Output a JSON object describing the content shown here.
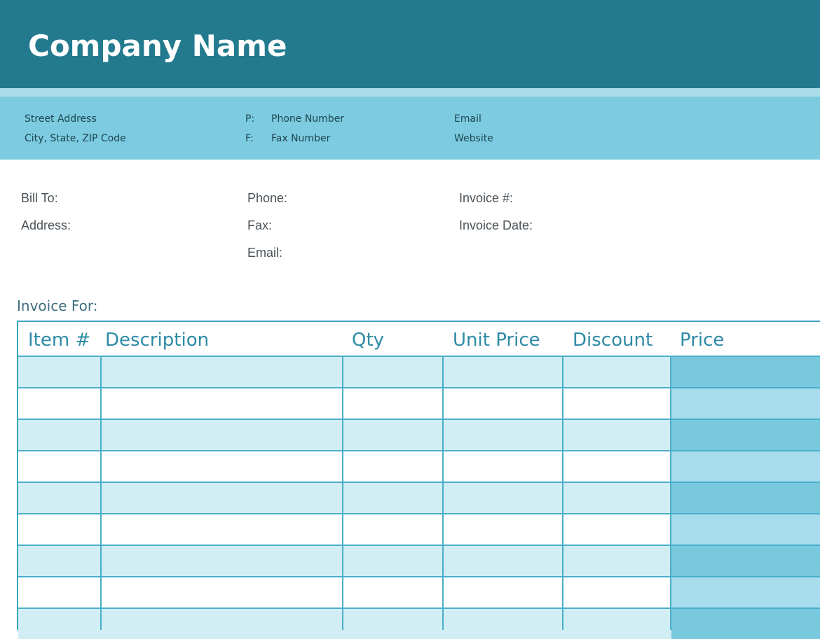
{
  "header": {
    "company_name": "Company Name"
  },
  "contact": {
    "street_address": "Street Address",
    "city_state_zip": "City, State, ZIP Code",
    "phone_prefix": "P:",
    "phone_number": "Phone Number",
    "fax_prefix": "F:",
    "fax_number": "Fax Number",
    "email": "Email",
    "website": "Website"
  },
  "bill_info": {
    "bill_to_label": "Bill To:",
    "address_label": "Address:",
    "phone_label": "Phone:",
    "fax_label": "Fax:",
    "email_label": "Email:",
    "invoice_number_label": "Invoice #:",
    "invoice_date_label": "Invoice Date:"
  },
  "invoice_for": {
    "label": "Invoice For:"
  },
  "table": {
    "columns": [
      "Item #",
      "Description",
      "Qty",
      "Unit Price",
      "Discount",
      "Price"
    ],
    "rows": [
      [
        "",
        "",
        "",
        "",
        "",
        ""
      ],
      [
        "",
        "",
        "",
        "",
        "",
        ""
      ],
      [
        "",
        "",
        "",
        "",
        "",
        ""
      ],
      [
        "",
        "",
        "",
        "",
        "",
        ""
      ],
      [
        "",
        "",
        "",
        "",
        "",
        ""
      ],
      [
        "",
        "",
        "",
        "",
        "",
        ""
      ],
      [
        "",
        "",
        "",
        "",
        "",
        ""
      ],
      [
        "",
        "",
        "",
        "",
        "",
        ""
      ],
      [
        "",
        "",
        "",
        "",
        "",
        ""
      ]
    ]
  },
  "colors": {
    "header_band": "#237a8e",
    "contact_band": "#7ccbe0",
    "row_shaded": "#d1eef5",
    "price_column": "#79c9de",
    "accent_text": "#2f8ba6"
  }
}
